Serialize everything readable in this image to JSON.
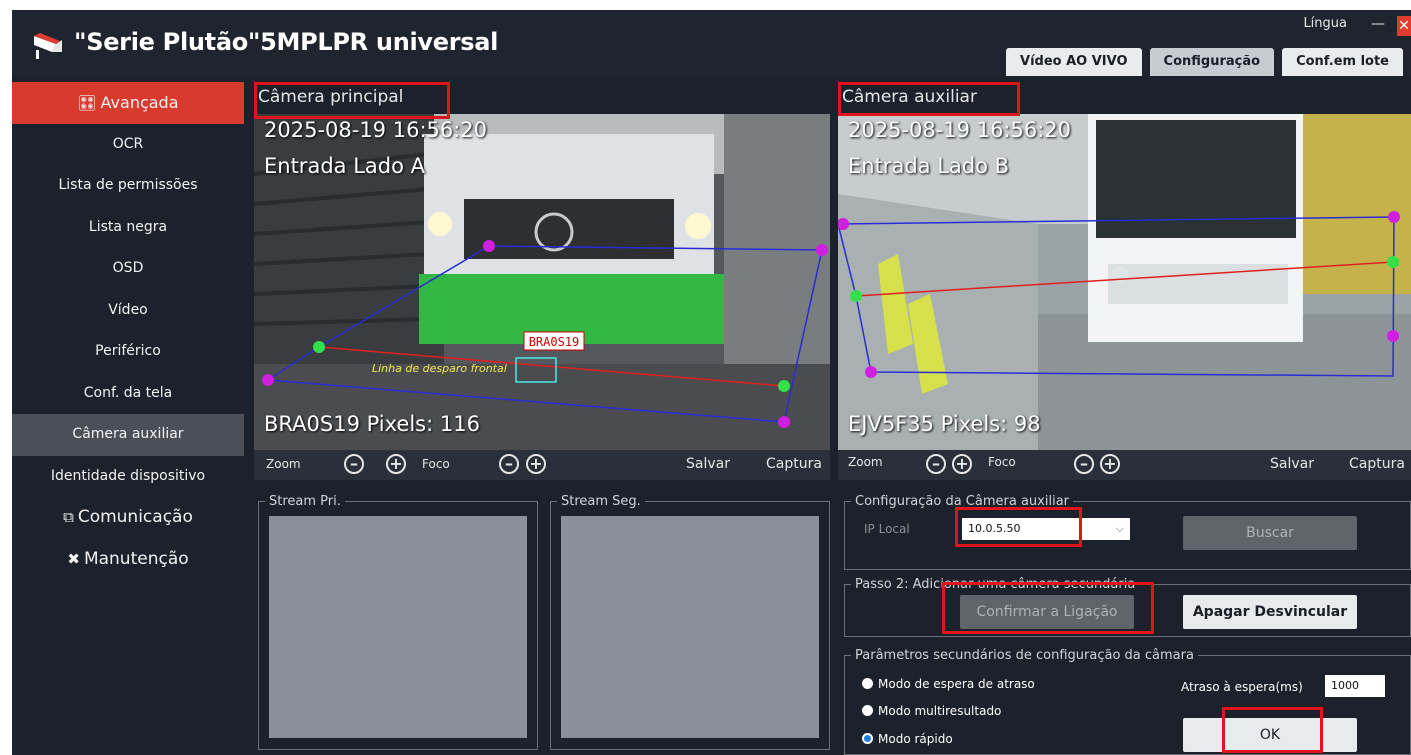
{
  "app": {
    "title": "\"Serie Plutão\"5MPLPR universal",
    "language_label": "Língua",
    "minimize_symbol": "—",
    "close_symbol": "✕"
  },
  "tabs": [
    {
      "label": "Vídeo AO VIVO",
      "active": false
    },
    {
      "label": "Configuração",
      "active": true
    },
    {
      "label": "Conf.em lote",
      "active": false
    }
  ],
  "sidebar": {
    "items": [
      {
        "label": "Avançada",
        "icon": "sliders-icon",
        "state": "active"
      },
      {
        "label": "OCR"
      },
      {
        "label": "Lista de permissões"
      },
      {
        "label": "Lista negra"
      },
      {
        "label": "OSD"
      },
      {
        "label": "Vídeo"
      },
      {
        "label": "Periférico"
      },
      {
        "label": "Conf. da tela"
      },
      {
        "label": "Câmera auxiliar",
        "state": "selected"
      },
      {
        "label": "Identidade dispositivo"
      },
      {
        "label": "Comunicação",
        "icon": "camera-icon",
        "state": "group"
      },
      {
        "label": "Manutenção",
        "icon": "tools-icon",
        "state": "group"
      }
    ]
  },
  "main_camera": {
    "title": "Câmera principal",
    "timestamp": "2025-08-19 16:56:20",
    "location": "Entrada Lado A",
    "plate_pixels": "BRA0S19 Pixels: 116",
    "plate_text": "BRA0S19",
    "trigger_line_label": "Linha de desparo frontal",
    "controls": {
      "zoom": "Zoom",
      "focus": "Foco",
      "save": "Salvar",
      "capture": "Captura"
    }
  },
  "aux_camera": {
    "title": "Câmera auxiliar",
    "timestamp": "2025-08-19 16:56:20",
    "location": "Entrada Lado B",
    "plate_pixels": "EJV5F35 Pixels: 98",
    "controls": {
      "zoom": "Zoom",
      "focus": "Foco",
      "save": "Salvar",
      "capture": "Captura"
    }
  },
  "streams": {
    "primary": "Stream Pri.",
    "secondary": "Stream Seg."
  },
  "aux_config": {
    "legend": "Configuração da Câmera auxiliar",
    "ip_label": "IP Local",
    "ip_value": "10.0.5.50",
    "search_button": "Buscar"
  },
  "step2": {
    "legend": "Passo 2: Adicionar uma câmera secundária",
    "confirm_button": "Confirmar a Ligação",
    "unlink_button": "Apagar Desvincular"
  },
  "params": {
    "legend": "Parâmetros secundários de configuração da câmara",
    "modes": [
      {
        "label": "Modo de espera de atraso",
        "selected": false
      },
      {
        "label": "Modo multiresultado",
        "selected": false
      },
      {
        "label": "Modo rápido",
        "selected": true
      }
    ],
    "delay_label": "Atraso à espera(ms)",
    "delay_value": "1000",
    "ok_button": "OK"
  },
  "colors": {
    "accent": "#d93a2e",
    "highlight_box": "#e0151b",
    "background": "#1c222b"
  }
}
